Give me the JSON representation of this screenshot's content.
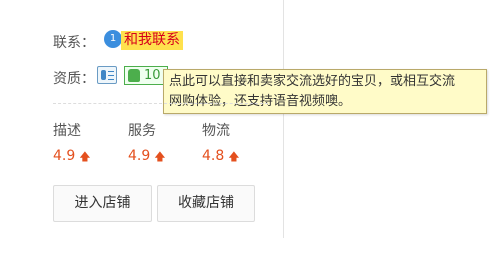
{
  "contact": {
    "label": "联系：",
    "icon_glyph": "1",
    "link_text": "和我联系"
  },
  "qualification": {
    "label": "资质：",
    "badge_number": "10"
  },
  "tooltip": {
    "line1": "点此可以直接和卖家交流选好的宝贝，或相互交流",
    "line2": "网购体验，还支持语音视频噢。"
  },
  "ratings": [
    {
      "name": "描述",
      "score": "4.9",
      "trend_icon": "arrow-up-icon"
    },
    {
      "name": "服务",
      "score": "4.9",
      "trend_icon": "arrow-up-icon"
    },
    {
      "name": "物流",
      "score": "4.8",
      "trend_icon": "arrow-up-icon"
    }
  ],
  "buttons": {
    "enter_shop": "进入店铺",
    "favorite_shop": "收藏店铺"
  },
  "colors": {
    "accent_red": "#d6001c",
    "highlight_yellow": "#ffe14d",
    "score_orange": "#e4501e",
    "tooltip_bg": "#fffbc8"
  }
}
